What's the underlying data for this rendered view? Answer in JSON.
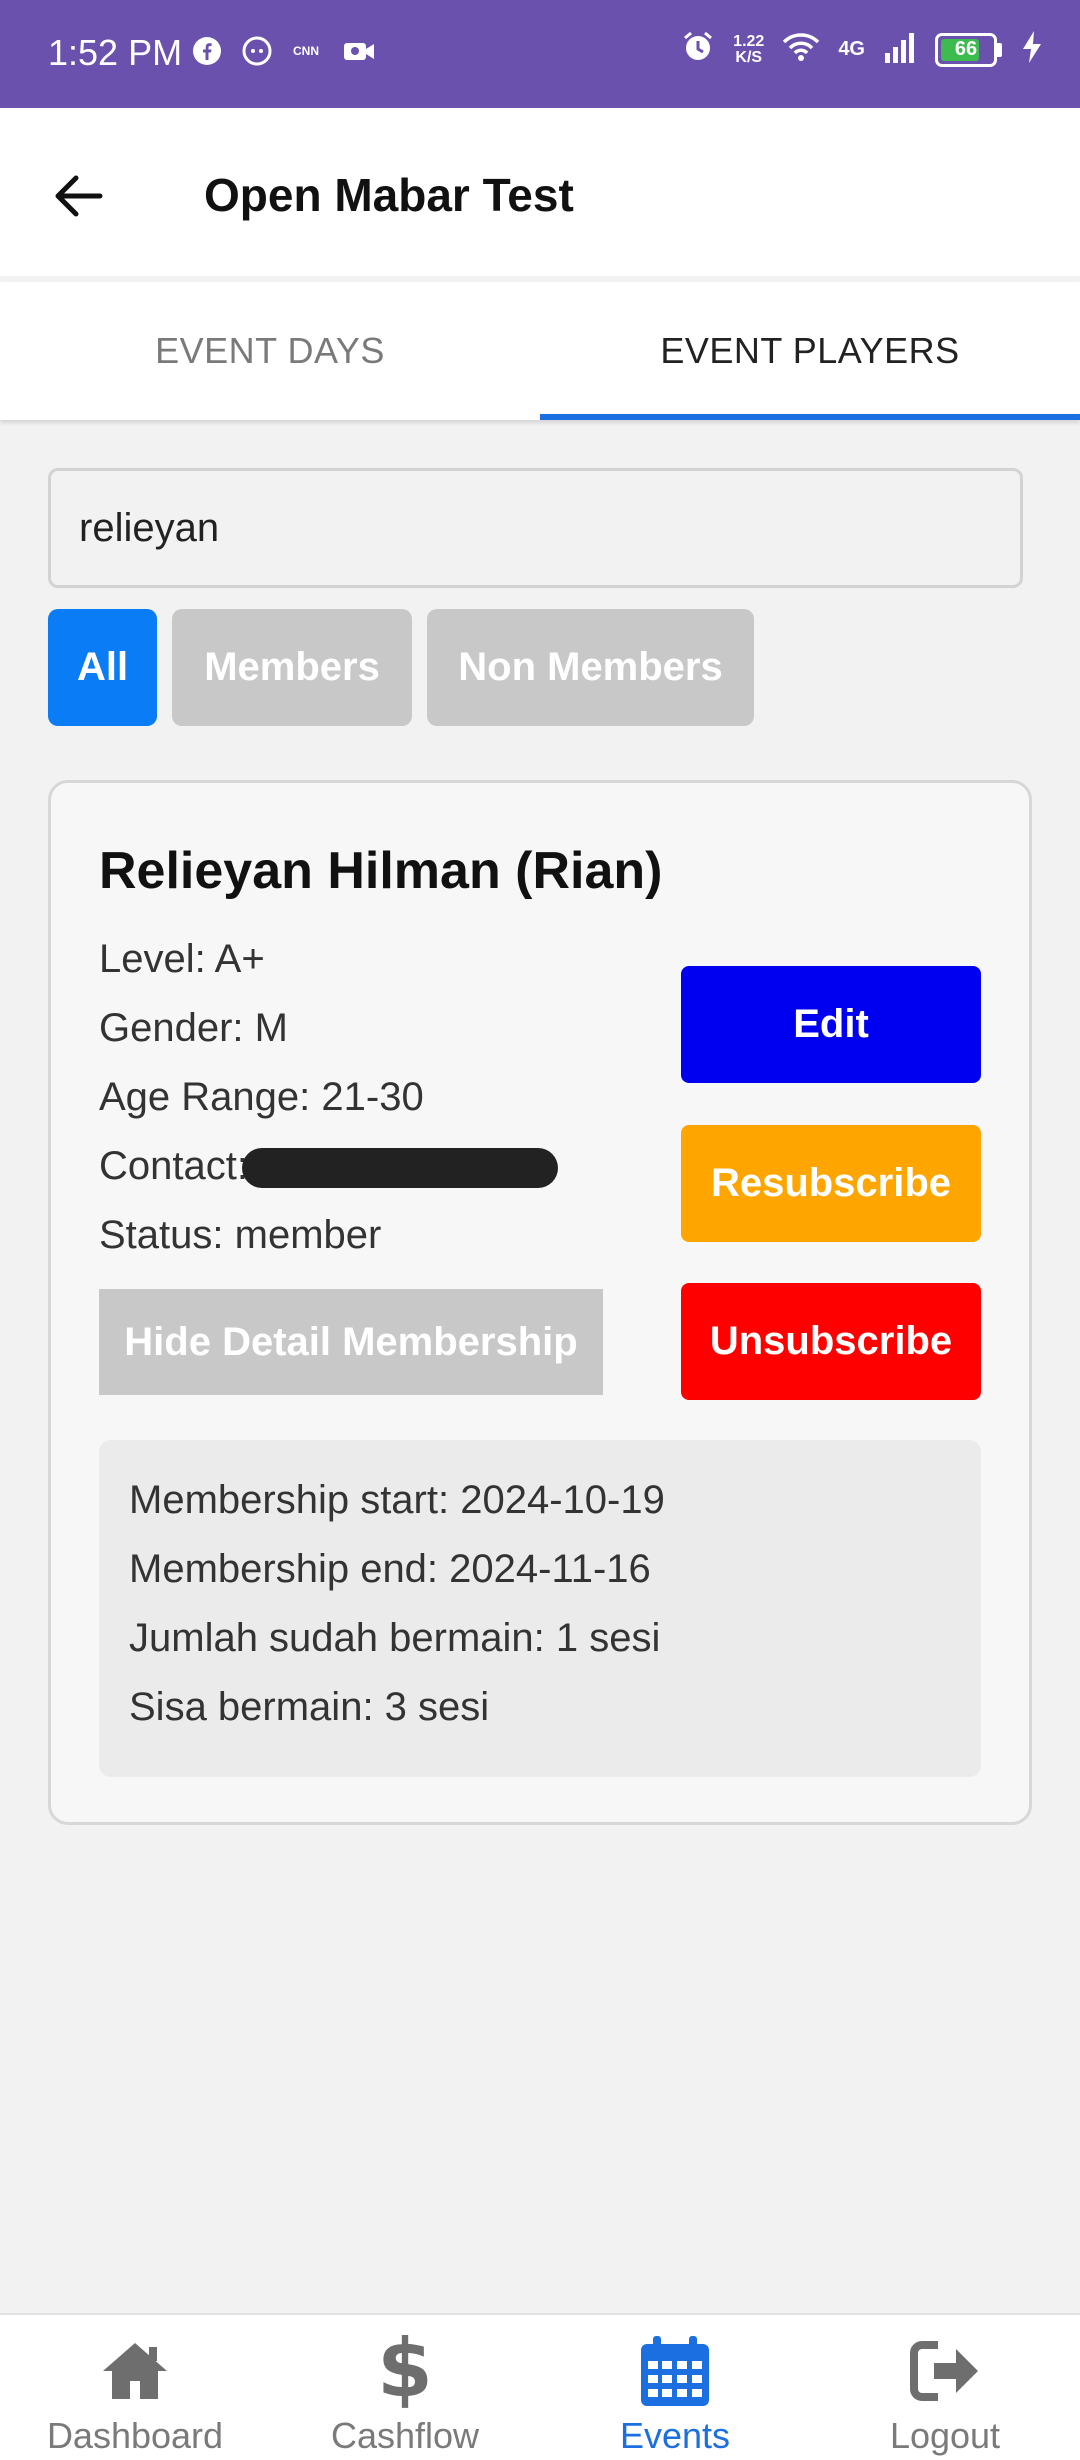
{
  "status_bar": {
    "time": "1:52 PM",
    "speed_value": "1.22",
    "speed_unit": "K/S",
    "network": "4G",
    "battery": "66"
  },
  "app_bar": {
    "title": "Open Mabar Test"
  },
  "tabs": [
    {
      "label": "EVENT DAYS"
    },
    {
      "label": "EVENT PLAYERS"
    }
  ],
  "search": {
    "value": "relieyan"
  },
  "filters": [
    {
      "label": "All"
    },
    {
      "label": "Members"
    },
    {
      "label": "Non Members"
    }
  ],
  "player": {
    "name": "Relieyan Hilman (Rian)",
    "level": "Level: A+",
    "gender": "Gender: M",
    "age_range": "Age Range: 21-30",
    "contact_label": "Contact:",
    "status": "Status: member",
    "hide_detail_label": "Hide Detail Membership",
    "edit_label": "Edit",
    "resubscribe_label": "Resubscribe",
    "unsubscribe_label": "Unsubscribe",
    "membership": {
      "start": "Membership start: 2024-10-19",
      "end": "Membership end: 2024-11-16",
      "played": "Jumlah sudah bermain: 1 sesi",
      "remaining": "Sisa bermain: 3 sesi"
    }
  },
  "bottom_nav": [
    {
      "label": "Dashboard",
      "icon": "home-icon"
    },
    {
      "label": "Cashflow",
      "icon": "dollar-icon"
    },
    {
      "label": "Events",
      "icon": "calendar-icon"
    },
    {
      "label": "Logout",
      "icon": "logout-icon"
    }
  ],
  "colors": {
    "status_bar": "#6a51ad",
    "accent": "#1c6fe0",
    "chip_active": "#0a7cf5",
    "edit": "#0000f0",
    "resubscribe": "#ffa500",
    "unsubscribe": "#ff0000"
  }
}
